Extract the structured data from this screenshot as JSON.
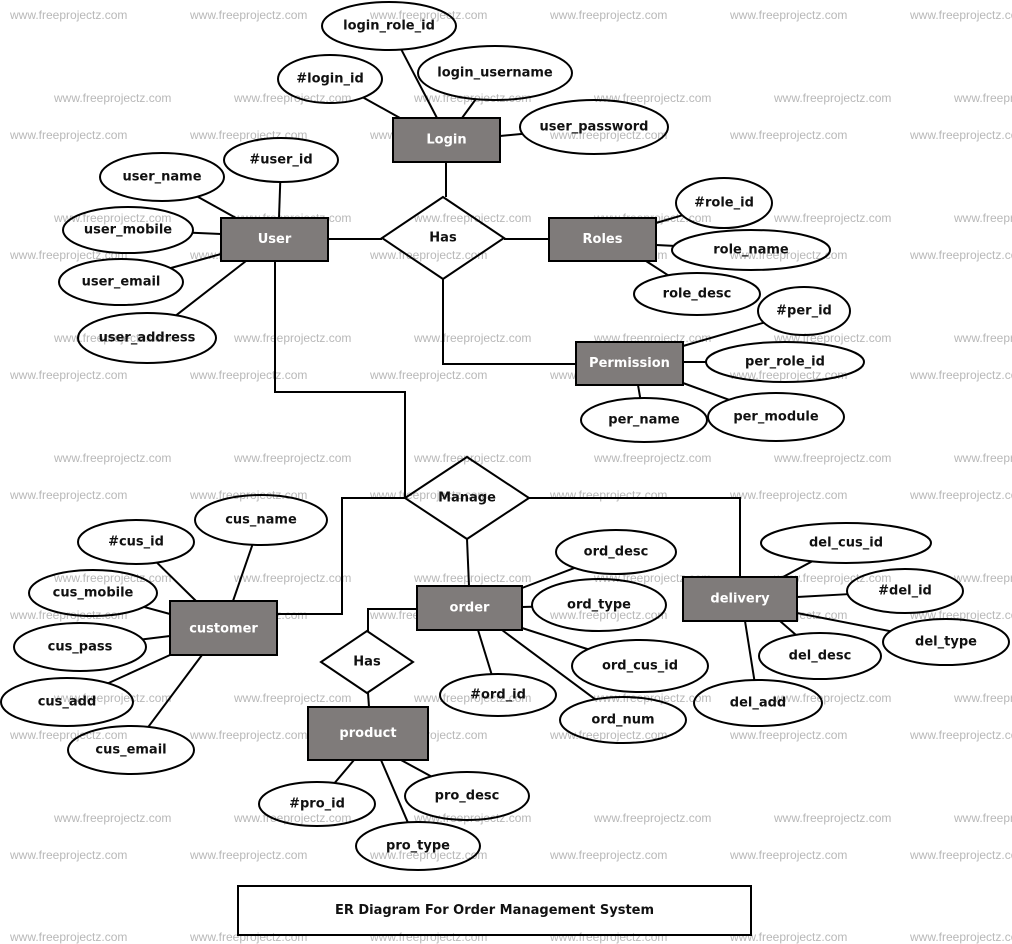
{
  "watermark_text": "www.freeprojectz.com",
  "title": "ER Diagram For Order Management System",
  "colors": {
    "entity_fill": "#7f7b7a",
    "line": "#000000",
    "entity_text": "#ffffff",
    "watermark": "#b8b8b8"
  },
  "entities": {
    "login": "Login",
    "user": "User",
    "roles": "Roles",
    "permission": "Permission",
    "customer": "customer",
    "order": "order",
    "delivery": "delivery",
    "product": "product"
  },
  "relationships": {
    "has_user": "Has",
    "manage": "Manage",
    "has_order": "Has"
  },
  "attributes": {
    "login": [
      "login_role_id",
      "#login_id",
      "login_username",
      "user_password"
    ],
    "user": [
      "#user_id",
      "user_name",
      "user_mobile",
      "user_email",
      "user_address"
    ],
    "roles": [
      "#role_id",
      "role_name",
      "role_desc"
    ],
    "permission": [
      "#per_id",
      "per_role_id",
      "per_name",
      "per_module"
    ],
    "customer": [
      "cus_name",
      "#cus_id",
      "cus_mobile",
      "cus_pass",
      "cus_add",
      "cus_email"
    ],
    "order": [
      "ord_desc",
      "ord_type",
      "ord_cus_id",
      "#ord_id",
      "ord_num"
    ],
    "delivery": [
      "del_cus_id",
      "#del_id",
      "del_type",
      "del_desc",
      "del_add"
    ],
    "product": [
      "#pro_id",
      "pro_desc",
      "pro_type"
    ]
  }
}
